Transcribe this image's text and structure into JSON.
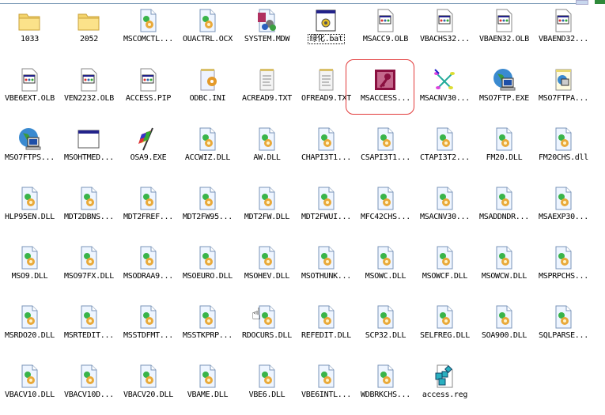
{
  "window": {
    "view": "icons"
  },
  "selected_label": "MSACCESS...",
  "focused_label": "绿化.bat",
  "items": [
    {
      "label": "1033",
      "icon": "folder-icon"
    },
    {
      "label": "2052",
      "icon": "folder-icon"
    },
    {
      "label": "MSCOMCTL...",
      "icon": "dll-icon"
    },
    {
      "label": "OUACTRL.OCX",
      "icon": "dll-icon"
    },
    {
      "label": "SYSTEM.MDW",
      "icon": "mdw-icon"
    },
    {
      "label": "绿化.bat",
      "icon": "bat-icon"
    },
    {
      "label": "MSACC9.OLB",
      "icon": "olb-icon"
    },
    {
      "label": "VBACHS32...",
      "icon": "olb-icon"
    },
    {
      "label": "VBAEN32.OLB",
      "icon": "olb-icon"
    },
    {
      "label": "VBAEND32...",
      "icon": "olb-icon"
    },
    {
      "label": "VBE6EXT.OLB",
      "icon": "olb-icon"
    },
    {
      "label": "VEN2232.OLB",
      "icon": "olb-icon"
    },
    {
      "label": "ACCESS.PIP",
      "icon": "olb-icon"
    },
    {
      "label": "ODBC.INI",
      "icon": "ini-icon"
    },
    {
      "label": "ACREAD9.TXT",
      "icon": "txt-icon"
    },
    {
      "label": "OFREAD9.TXT",
      "icon": "txt-icon"
    },
    {
      "label": "MSACCESS...",
      "icon": "access-icon"
    },
    {
      "label": "MSACNV30...",
      "icon": "msacnv-icon"
    },
    {
      "label": "MSO7FTP.EXE",
      "icon": "ftp-icon"
    },
    {
      "label": "MSO7FTPA...",
      "icon": "ftpa-icon"
    },
    {
      "label": "MSO7FTPS...",
      "icon": "ftp-icon"
    },
    {
      "label": "MSOHTMED...",
      "icon": "window-icon"
    },
    {
      "label": "OSA9.EXE",
      "icon": "flag-icon"
    },
    {
      "label": "ACCWIZ.DLL",
      "icon": "dll-icon"
    },
    {
      "label": "AW.DLL",
      "icon": "dll-icon"
    },
    {
      "label": "CHAPI3T1...",
      "icon": "dll-icon"
    },
    {
      "label": "CSAPI3T1...",
      "icon": "dll-icon"
    },
    {
      "label": "CTAPI3T2...",
      "icon": "dll-icon"
    },
    {
      "label": "FM20.DLL",
      "icon": "dll-icon"
    },
    {
      "label": "FM20CHS.dll",
      "icon": "dll-icon"
    },
    {
      "label": "HLP95EN.DLL",
      "icon": "dll-icon"
    },
    {
      "label": "MDT2DBNS...",
      "icon": "dll-icon"
    },
    {
      "label": "MDT2FREF...",
      "icon": "dll-icon"
    },
    {
      "label": "MDT2FW95...",
      "icon": "dll-icon"
    },
    {
      "label": "MDT2FW.DLL",
      "icon": "dll-icon"
    },
    {
      "label": "MDT2FWUI...",
      "icon": "dll-icon"
    },
    {
      "label": "MFC42CHS...",
      "icon": "dll-icon"
    },
    {
      "label": "MSACNV30...",
      "icon": "dll-icon"
    },
    {
      "label": "MSADDNDR...",
      "icon": "dll-icon"
    },
    {
      "label": "MSAEXP30...",
      "icon": "dll-icon"
    },
    {
      "label": "MSO9.DLL",
      "icon": "dll-icon"
    },
    {
      "label": "MSO97FX.DLL",
      "icon": "dll-icon"
    },
    {
      "label": "MSODRAA9...",
      "icon": "dll-icon"
    },
    {
      "label": "MSOEURO.DLL",
      "icon": "dll-icon"
    },
    {
      "label": "MSOHEV.DLL",
      "icon": "dll-icon"
    },
    {
      "label": "MSOTHUNK...",
      "icon": "dll-icon"
    },
    {
      "label": "MSOWC.DLL",
      "icon": "dll-icon"
    },
    {
      "label": "MSOWCF.DLL",
      "icon": "dll-icon"
    },
    {
      "label": "MSOWCW.DLL",
      "icon": "dll-icon"
    },
    {
      "label": "MSPRPCHS...",
      "icon": "dll-icon"
    },
    {
      "label": "MSRDO20.DLL",
      "icon": "dll-icon"
    },
    {
      "label": "MSRTEDIT...",
      "icon": "dll-icon"
    },
    {
      "label": "MSSTDFMT...",
      "icon": "dll-icon"
    },
    {
      "label": "MSSTKPRP...",
      "icon": "dll-icon"
    },
    {
      "label": "RDOCURS.DLL",
      "icon": "dll-icon"
    },
    {
      "label": "REFEDIT.DLL",
      "icon": "dll-icon"
    },
    {
      "label": "SCP32.DLL",
      "icon": "dll-icon"
    },
    {
      "label": "SELFREG.DLL",
      "icon": "dll-icon"
    },
    {
      "label": "SOA900.DLL",
      "icon": "dll-icon"
    },
    {
      "label": "SQLPARSE...",
      "icon": "dll-icon"
    },
    {
      "label": "VBACV10.DLL",
      "icon": "dll-icon"
    },
    {
      "label": "VBACV10D...",
      "icon": "dll-icon"
    },
    {
      "label": "VBACV20.DLL",
      "icon": "dll-icon"
    },
    {
      "label": "VBAME.DLL",
      "icon": "dll-icon"
    },
    {
      "label": "VBE6.DLL",
      "icon": "dll-icon"
    },
    {
      "label": "VBE6INTL...",
      "icon": "dll-icon"
    },
    {
      "label": "WDBRKCHS...",
      "icon": "dll-icon"
    },
    {
      "label": "access.reg",
      "icon": "reg-icon"
    }
  ]
}
